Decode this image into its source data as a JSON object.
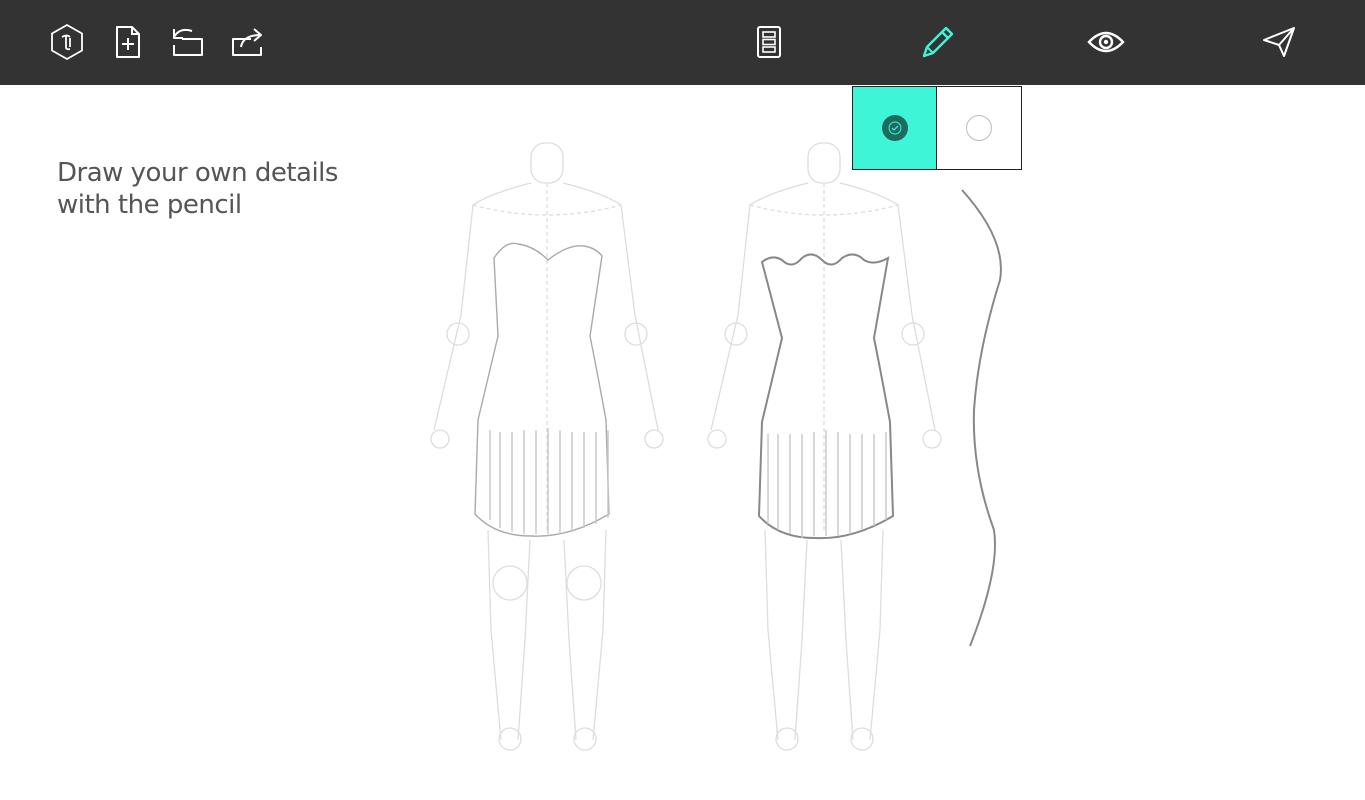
{
  "toolbar": {
    "left_tools": [
      {
        "name": "logo-icon"
      },
      {
        "name": "new-page-icon"
      },
      {
        "name": "undo-icon"
      },
      {
        "name": "share-icon"
      }
    ],
    "center_tools": [
      {
        "name": "layers-icon"
      },
      {
        "name": "pencil-icon"
      },
      {
        "name": "eye-icon"
      },
      {
        "name": "send-icon"
      }
    ],
    "active_tool": "pencil",
    "accent_color": "#3ef5d8",
    "background_color": "#333333"
  },
  "hint": {
    "line1": "Draw your own details",
    "line2": "with the pencil"
  },
  "pencil_colors": [
    {
      "name": "teal",
      "color": "#3ef5d8",
      "selected": true
    },
    {
      "name": "white",
      "color": "#ffffff",
      "selected": false
    }
  ]
}
